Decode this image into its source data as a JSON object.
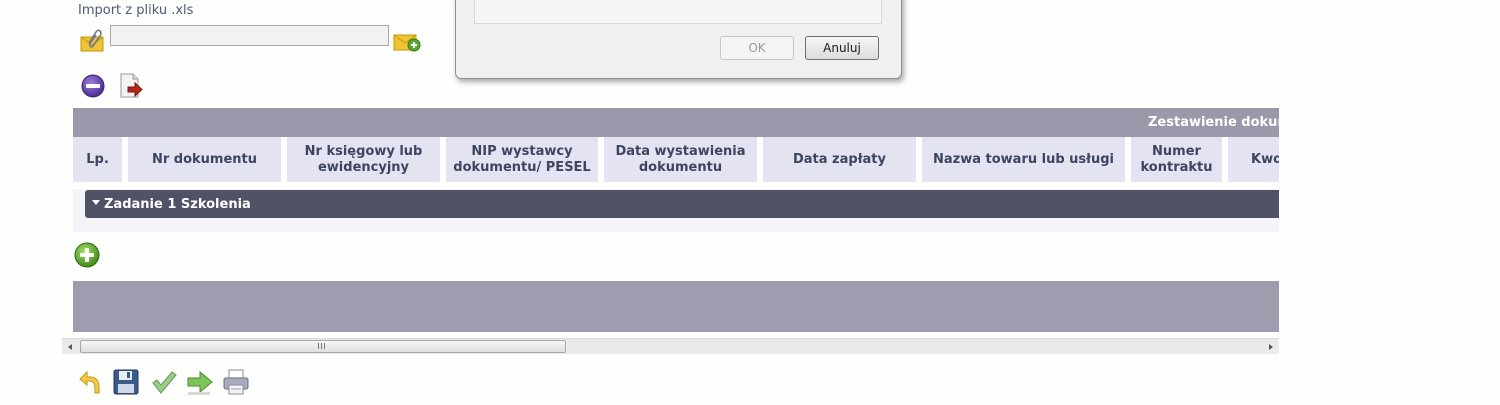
{
  "import_section": {
    "label": "Import z pliku .xls",
    "file_value": ""
  },
  "dialog": {
    "ok_label": "OK",
    "cancel_label": "Anuluj"
  },
  "table": {
    "header_title": "Zestawienie dokum",
    "columns": [
      "Lp.",
      "Nr dokumentu",
      "Nr księgowy lub\newidencyjny",
      "NIP wystawcy\ndokumentu/ PESEL",
      "Data wystawienia\ndokumentu",
      "Data zapłaty",
      "Nazwa towaru lub usługi",
      "Numer\nkontraktu",
      "Kwo"
    ],
    "group_row": "Zadanie 1 Szkolenia"
  },
  "scrollbar": {
    "grip_glyph": "III"
  },
  "icons": {
    "attach": "attach-envelope-icon",
    "add_file": "add-envelope-icon",
    "remove": "remove-icon",
    "export": "export-document-icon",
    "add_row": "add-icon",
    "toolbar": [
      "undo-icon",
      "save-icon",
      "check-icon",
      "forward-icon",
      "print-icon"
    ]
  },
  "colors": {
    "header_bar": "#9999ab",
    "column_header_bg": "#e3e3f1",
    "group_row_bg": "#505266",
    "footer_bar": "#9d9daf",
    "header_text": "#3d4560"
  }
}
